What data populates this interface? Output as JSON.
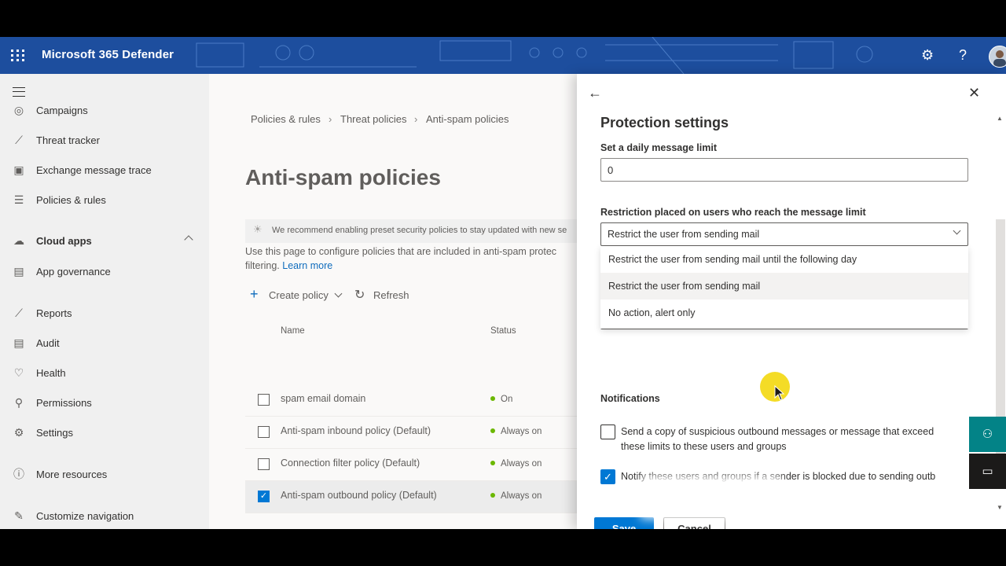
{
  "header": {
    "app_title": "Microsoft 365 Defender",
    "settings_icon": "gear-icon",
    "help_icon": "question-icon",
    "help_glyph": "?",
    "settings_glyph": "⚙"
  },
  "sidebar": {
    "items": [
      {
        "label": "Campaigns",
        "icon": "campaigns-icon",
        "glyph": "◎"
      },
      {
        "label": "Threat tracker",
        "icon": "chart-icon",
        "glyph": "⟋"
      },
      {
        "label": "Exchange message trace",
        "icon": "exchange-icon",
        "glyph": "▣"
      },
      {
        "label": "Policies & rules",
        "icon": "sliders-icon",
        "glyph": "☰"
      },
      {
        "label": "Cloud apps",
        "icon": "cloud-icon",
        "glyph": "☁"
      },
      {
        "label": "App governance",
        "icon": "clipboard-icon",
        "glyph": "▤"
      },
      {
        "label": "Reports",
        "icon": "reports-icon",
        "glyph": "⟋"
      },
      {
        "label": "Audit",
        "icon": "audit-icon",
        "glyph": "▤"
      },
      {
        "label": "Health",
        "icon": "heart-icon",
        "glyph": "♡"
      },
      {
        "label": "Permissions",
        "icon": "key-icon",
        "glyph": "⚲"
      },
      {
        "label": "Settings",
        "icon": "gear-icon",
        "glyph": "⚙"
      },
      {
        "label": "More resources",
        "icon": "info-icon",
        "glyph": "ⓘ"
      },
      {
        "label": "Customize navigation",
        "icon": "pencil-icon",
        "glyph": "✎"
      }
    ]
  },
  "main": {
    "breadcrumb": [
      "Policies & rules",
      "Threat policies",
      "Anti-spam policies"
    ],
    "title": "Anti-spam policies",
    "banner": "We recommend enabling preset security policies to stay updated with new se",
    "description": "Use this page to configure policies that are included in anti-spam protec filtering.",
    "learn_more": "Learn more",
    "commands": {
      "create": "Create policy",
      "refresh": "Refresh"
    },
    "columns": {
      "name": "Name",
      "status": "Status"
    },
    "rows": [
      {
        "name": "spam email domain",
        "status": "On",
        "checked": false
      },
      {
        "name": "Anti-spam inbound policy (Default)",
        "status": "Always on",
        "checked": false
      },
      {
        "name": "Connection filter policy (Default)",
        "status": "Always on",
        "checked": false
      },
      {
        "name": "Anti-spam outbound policy (Default)",
        "status": "Always on",
        "checked": true
      }
    ]
  },
  "panel": {
    "title": "Protection settings",
    "daily_limit_label": "Set a daily message limit",
    "daily_limit_value": "0",
    "restriction_label": "Restriction placed on users who reach the message limit",
    "restriction_value": "Restrict the user from sending mail",
    "restriction_options": [
      "Restrict the user from sending mail until the following day",
      "Restrict the user from sending mail",
      "No action, alert only"
    ],
    "notifications_label": "Notifications",
    "send_copy_text": "Send a copy of suspicious outbound messages or message that exceed these limits to these users and groups",
    "send_copy_checked": false,
    "notify_text": "Notify these users and groups if a sender is blocked due to sending outb",
    "notify_checked": true,
    "save_label": "Save",
    "cancel_label": "Cancel"
  },
  "colors": {
    "accent": "#0078d4",
    "header": "#1d4e9e",
    "status_green": "#6bb700",
    "side_button": "#038387"
  }
}
